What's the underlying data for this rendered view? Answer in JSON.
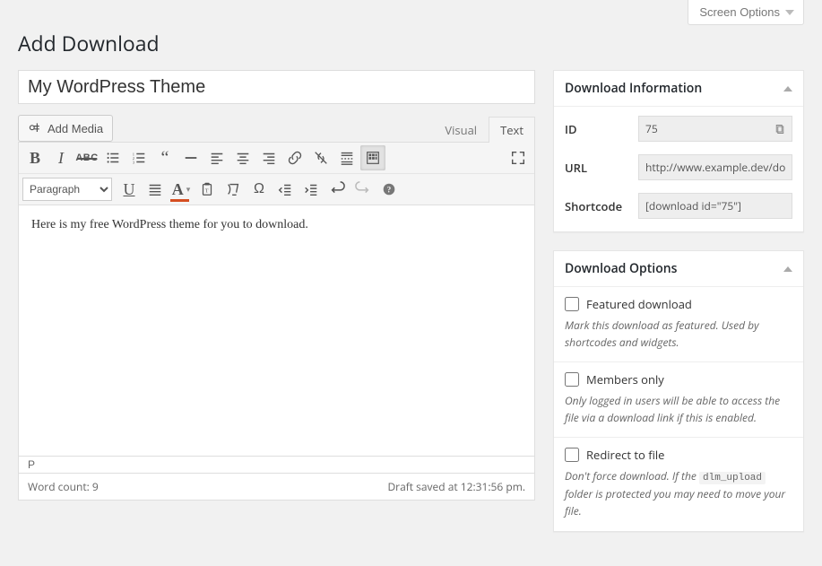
{
  "screen_options_label": "Screen Options",
  "page_title": "Add Download",
  "post_title": "My WordPress Theme",
  "add_media_label": "Add Media",
  "tabs": {
    "visual": "Visual",
    "text": "Text"
  },
  "format_select": "Paragraph",
  "editor_content": "Here is my free WordPress theme for you to download.",
  "path_bar": "P",
  "word_count_label": "Word count: 9",
  "autosave_label": "Draft saved at 12:31:56 pm.",
  "box_info": {
    "title": "Download Information",
    "id_label": "ID",
    "id_value": "75",
    "url_label": "URL",
    "url_value": "http://www.example.dev/down",
    "shortcode_label": "Shortcode",
    "shortcode_value": "[download id=\"75\"]"
  },
  "box_options": {
    "title": "Download Options",
    "featured_label": "Featured download",
    "featured_desc": "Mark this download as featured. Used by shortcodes and widgets.",
    "members_label": "Members only",
    "members_desc": "Only logged in users will be able to access the file via a download link if this is enabled.",
    "redirect_label": "Redirect to file",
    "redirect_desc_pre": "Don't force download. If the ",
    "redirect_code": "dlm_upload",
    "redirect_desc_post": " folder is protected you may need to move your file."
  }
}
